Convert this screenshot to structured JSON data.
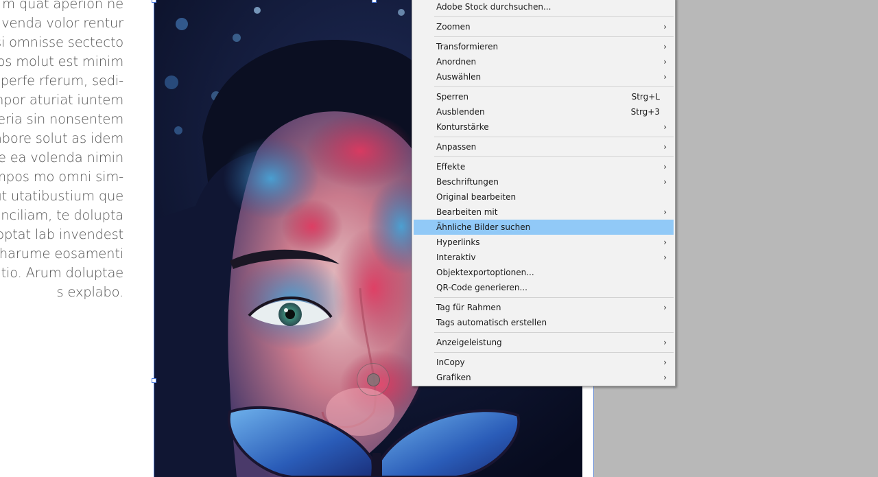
{
  "body_text_lines": [
    "m quat aperion ne",
    "a venda volor rentur",
    "si omnisse sectecto",
    "hos molut est minim",
    "reperfe rferum, sedi-",
    "mpor aturiat iuntem",
    "eria sin nonsentem",
    "abore solut as idem",
    "e ea volenda nimin",
    "mpos mo omni sim-",
    "ut utatibustium que",
    "inciliam, te dolupta",
    ", optat lab invendest",
    "harume eosamenti",
    "atio. Arum doluptae",
    "s explabo."
  ],
  "context_menu": {
    "items": [
      {
        "label": "Adobe Stock durchsuchen...",
        "submenu": false,
        "shortcut": "",
        "sep_after": true
      },
      {
        "label": "Zoomen",
        "submenu": true,
        "shortcut": "",
        "sep_after": true
      },
      {
        "label": "Transformieren",
        "submenu": true,
        "shortcut": "",
        "sep_after": false
      },
      {
        "label": "Anordnen",
        "submenu": true,
        "shortcut": "",
        "sep_after": false
      },
      {
        "label": "Auswählen",
        "submenu": true,
        "shortcut": "",
        "sep_after": true
      },
      {
        "label": "Sperren",
        "submenu": false,
        "shortcut": "Strg+L",
        "sep_after": false
      },
      {
        "label": "Ausblenden",
        "submenu": false,
        "shortcut": "Strg+3",
        "sep_after": false
      },
      {
        "label": "Konturstärke",
        "submenu": true,
        "shortcut": "",
        "sep_after": true
      },
      {
        "label": "Anpassen",
        "submenu": true,
        "shortcut": "",
        "sep_after": true
      },
      {
        "label": "Effekte",
        "submenu": true,
        "shortcut": "",
        "sep_after": false
      },
      {
        "label": "Beschriftungen",
        "submenu": true,
        "shortcut": "",
        "sep_after": false
      },
      {
        "label": "Original bearbeiten",
        "submenu": false,
        "shortcut": "",
        "sep_after": false
      },
      {
        "label": "Bearbeiten mit",
        "submenu": true,
        "shortcut": "",
        "sep_after": false
      },
      {
        "label": "Ähnliche Bilder suchen",
        "submenu": false,
        "shortcut": "",
        "sep_after": false,
        "highlighted": true
      },
      {
        "label": "Hyperlinks",
        "submenu": true,
        "shortcut": "",
        "sep_after": false
      },
      {
        "label": "Interaktiv",
        "submenu": true,
        "shortcut": "",
        "sep_after": false
      },
      {
        "label": "Objektexportoptionen...",
        "submenu": false,
        "shortcut": "",
        "sep_after": false
      },
      {
        "label": "QR-Code generieren...",
        "submenu": false,
        "shortcut": "",
        "sep_after": true
      },
      {
        "label": "Tag für Rahmen",
        "submenu": true,
        "shortcut": "",
        "sep_after": false
      },
      {
        "label": "Tags automatisch erstellen",
        "submenu": false,
        "shortcut": "",
        "sep_after": true
      },
      {
        "label": "Anzeigeleistung",
        "submenu": true,
        "shortcut": "",
        "sep_after": true
      },
      {
        "label": "InCopy",
        "submenu": true,
        "shortcut": "",
        "sep_after": false
      },
      {
        "label": "Grafiken",
        "submenu": true,
        "shortcut": "",
        "sep_after": false
      }
    ],
    "submenu_arrow": "›",
    "highlight_color": "#91c9f7"
  },
  "colors": {
    "pasteboard": "#b8b8b8",
    "frame_selection": "#4d7de0",
    "menu_background": "#f2f2f2"
  },
  "icons": {
    "cursor": "touch-cursor-icon",
    "submenu": "chevron-right-icon"
  }
}
